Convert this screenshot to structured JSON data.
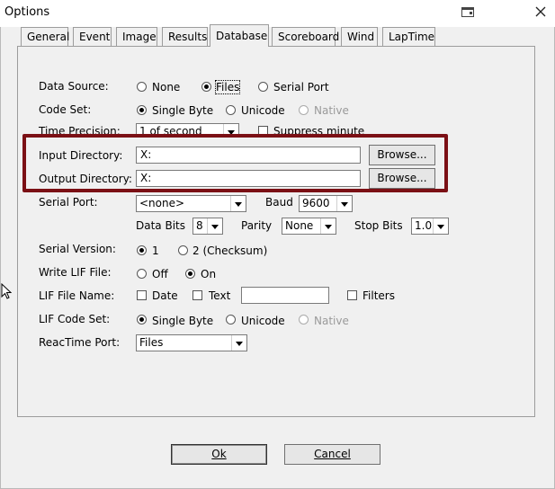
{
  "window": {
    "title": "Options"
  },
  "tabs": [
    "General",
    "Event",
    "Image",
    "Results",
    "Database",
    "Scoreboard",
    "Wind",
    "LapTime"
  ],
  "form": {
    "data_source": {
      "label": "Data Source:",
      "options": [
        "None",
        "Files",
        "Serial Port"
      ]
    },
    "code_set": {
      "label": "Code Set:",
      "options": [
        "Single Byte",
        "Unicode",
        "Native"
      ]
    },
    "time_precision": {
      "label": "Time Precision:",
      "value": "1 of second",
      "suppress_label": "Suppress minute"
    },
    "input_directory": {
      "label": "Input Directory:",
      "value": "X:",
      "browse": "Browse..."
    },
    "output_directory": {
      "label": "Output Directory:",
      "value": "X:",
      "browse": "Browse..."
    },
    "serial_port": {
      "label": "Serial Port:",
      "value": "<none>",
      "baud_label": "Baud",
      "baud_value": "9600"
    },
    "serial_params": {
      "data_bits_label": "Data Bits",
      "data_bits_value": "8",
      "parity_label": "Parity",
      "parity_value": "None",
      "stop_bits_label": "Stop Bits",
      "stop_bits_value": "1.0"
    },
    "serial_version": {
      "label": "Serial Version:",
      "options": [
        "1",
        "2 (Checksum)"
      ]
    },
    "write_lif": {
      "label": "Write LIF File:",
      "options": [
        "Off",
        "On"
      ]
    },
    "lif_file_name": {
      "label": "LIF File Name:",
      "date": "Date",
      "text": "Text",
      "filters": "Filters"
    },
    "lif_code_set": {
      "label": "LIF Code Set:",
      "options": [
        "Single Byte",
        "Unicode",
        "Native"
      ]
    },
    "reactime_port": {
      "label": "ReacTime Port:",
      "value": "Files"
    }
  },
  "buttons": {
    "ok": "Ok",
    "cancel": "Cancel"
  }
}
